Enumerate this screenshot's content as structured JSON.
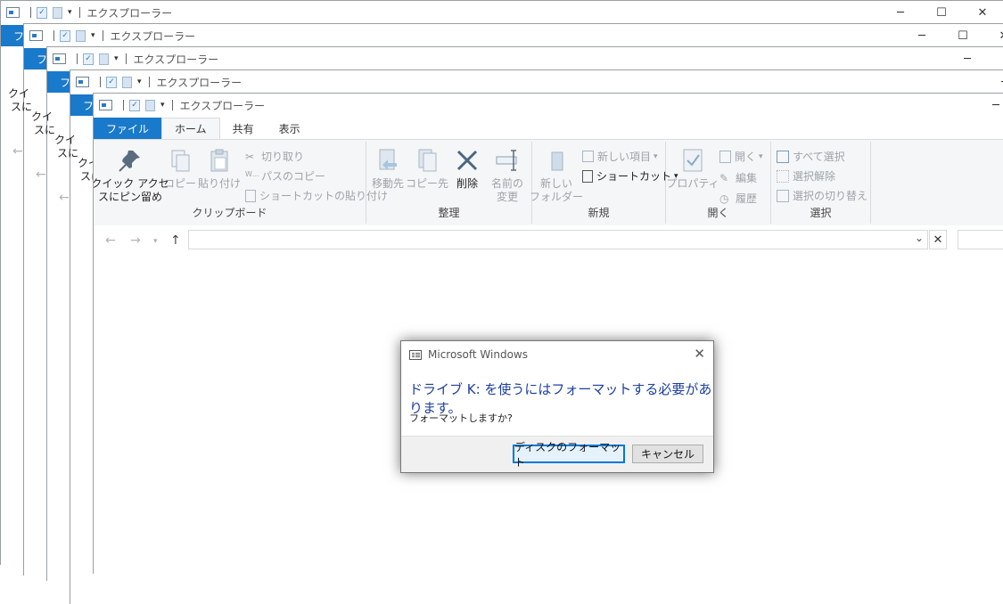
{
  "window": {
    "title": "エクスプローラー",
    "tabs": {
      "file": "ファイル",
      "home": "ホーム",
      "share": "共有",
      "view": "表示"
    },
    "back_window_partial": {
      "file_tab": "ファ",
      "pin_label_1": "クイ",
      "pin_label_2": "スに"
    }
  },
  "ribbon": {
    "clipboard": {
      "label": "クリップボード",
      "pin": "クイック アクセ\nスにピン留め",
      "copy": "コピー",
      "paste": "貼り付け",
      "cut": "切り取り",
      "copy_path": "パスのコピー",
      "paste_shortcut": "ショートカットの貼り付け"
    },
    "organize": {
      "label": "整理",
      "move_to": "移動先",
      "copy_to": "コピー先",
      "delete": "削除",
      "rename": "名前の\n変更"
    },
    "new": {
      "label": "新規",
      "new_folder": "新しい\nフォルダー",
      "new_item": "新しい項目",
      "shortcut": "ショートカット"
    },
    "open": {
      "label": "開く",
      "properties": "プロパティ",
      "open": "開く",
      "edit": "編集",
      "history": "履歴"
    },
    "select": {
      "label": "選択",
      "select_all": "すべて選択",
      "select_none": "選択解除",
      "invert": "選択の切り替え"
    }
  },
  "dialog": {
    "title": "Microsoft Windows",
    "message": "ドライブ K: を使うにはフォーマットする必要があります。",
    "question": "フォーマットしますか?",
    "format_button": "ディスクのフォーマット",
    "cancel_button": "キャンセル"
  },
  "colors": {
    "file_tab": "#1979ca",
    "accent": "#0078d7",
    "dialog_text": "#1c3fa0"
  }
}
